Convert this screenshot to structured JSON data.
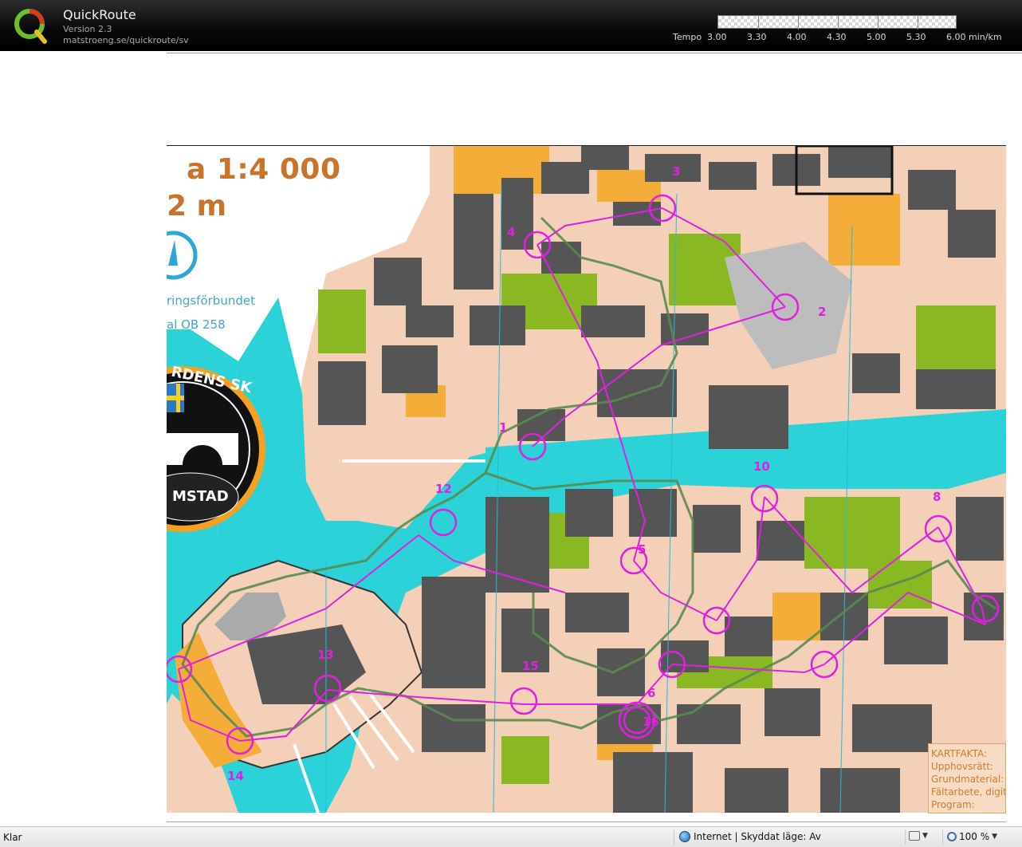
{
  "app": {
    "title": "QuickRoute",
    "version": "Version 2.3",
    "url": "matstroeng.se/quickroute/sv",
    "logo_letter": "Q"
  },
  "tempo": {
    "prefix": "Tempo",
    "values": [
      "3.00",
      "3.30",
      "4.00",
      "4.30",
      "5.00",
      "5.30",
      "6.00"
    ],
    "unit": "min/km"
  },
  "map": {
    "scale": "a 1:4 000",
    "equidistance": "2 m",
    "federation": "ringsförbundet",
    "club_code": "al    OB 258",
    "club_logo_top": "RDENS SK",
    "club_logo_bottom": "MSTAD",
    "kartfakta": [
      "KARTFAKTA:",
      "Upphovsrätt:",
      "Grundmaterial:",
      "Fältarbete, digit",
      "Program:"
    ],
    "controls": [
      "1",
      "2",
      "3",
      "4",
      "5",
      "6",
      "8",
      "10",
      "12",
      "13",
      "14",
      "15",
      "16"
    ]
  },
  "colors": {
    "water": "#2bd2d8",
    "building": "#555555",
    "paved": "#f5d0b8",
    "vegetation": "#8ab823",
    "open": "#f5ad3a",
    "course": "#e020e0",
    "route": "#5a8a50",
    "map_text": "#c9742a"
  },
  "statusbar": {
    "left": "Klar",
    "zone": "Internet | Skyddat läge: Av",
    "zoom": "100 %"
  }
}
